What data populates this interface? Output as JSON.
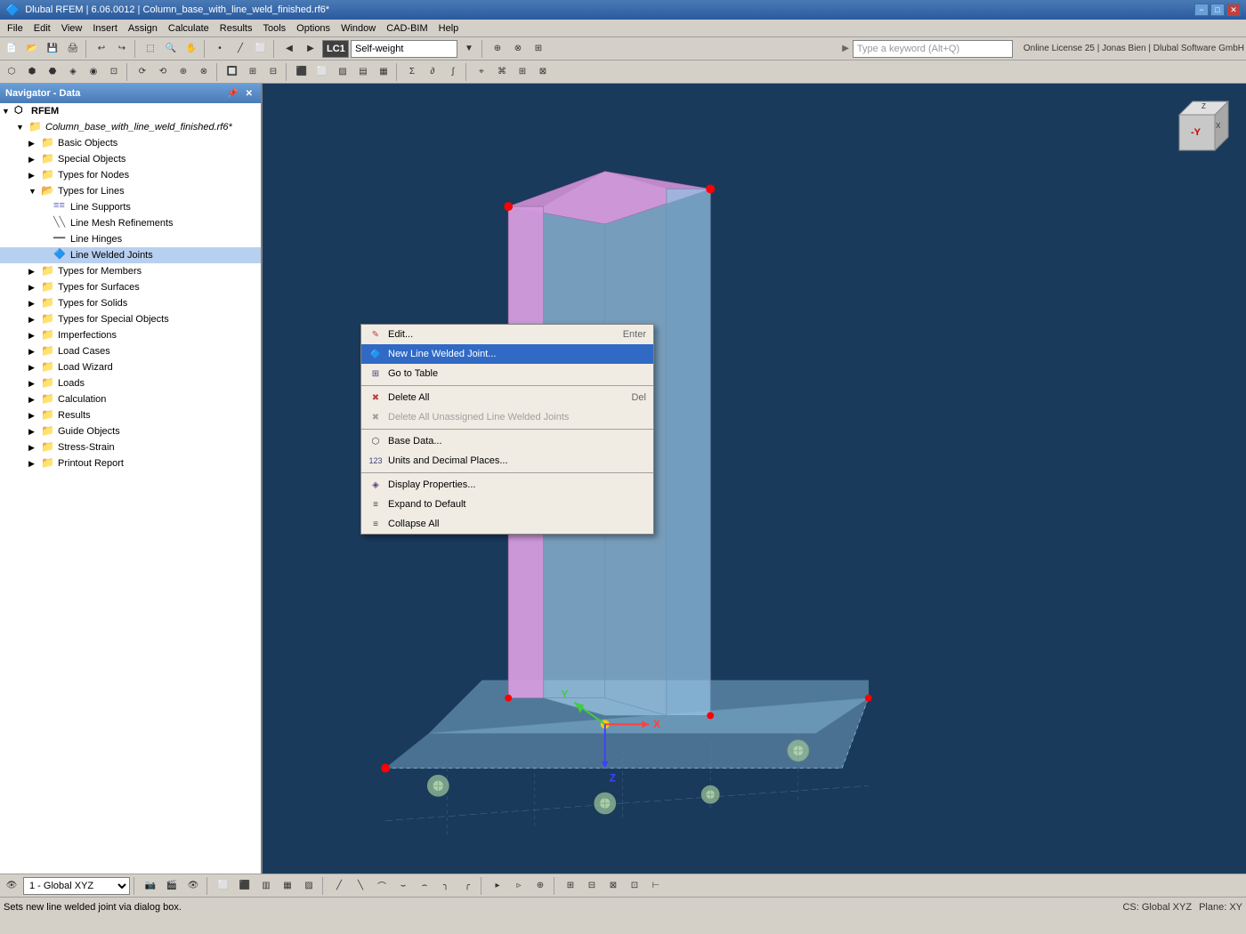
{
  "titlebar": {
    "title": "Dlubal RFEM | 6.06.0012 | Column_base_with_line_weld_finished.rf6*",
    "minimize": "−",
    "maximize": "□",
    "close": "✕"
  },
  "menubar": {
    "items": [
      "File",
      "Edit",
      "View",
      "Insert",
      "Assign",
      "Calculate",
      "Results",
      "Tools",
      "Options",
      "Window",
      "CAD-BIM",
      "Help"
    ]
  },
  "topbar": {
    "search_placeholder": "Type a keyword (Alt+Q)",
    "license_info": "Online License 25 | Jonas Bien | Dlubal Software GmbH",
    "lc_label": "LC1",
    "load_case": "Self-weight"
  },
  "navigator": {
    "title": "Navigator - Data",
    "root": "RFEM",
    "file": "Column_base_with_line_weld_finished.rf6*",
    "tree_items": [
      {
        "label": "Basic Objects",
        "level": 2,
        "type": "folder",
        "expanded": false
      },
      {
        "label": "Special Objects",
        "level": 2,
        "type": "folder",
        "expanded": false
      },
      {
        "label": "Types for Nodes",
        "level": 2,
        "type": "folder",
        "expanded": false
      },
      {
        "label": "Types for Lines",
        "level": 2,
        "type": "folder",
        "expanded": true
      },
      {
        "label": "Line Supports",
        "level": 3,
        "type": "item"
      },
      {
        "label": "Line Mesh Refinements",
        "level": 3,
        "type": "item"
      },
      {
        "label": "Line Hinges",
        "level": 3,
        "type": "item"
      },
      {
        "label": "Line Welded Joints",
        "level": 3,
        "type": "item",
        "selected": true
      },
      {
        "label": "Types for Members",
        "level": 2,
        "type": "folder",
        "expanded": false
      },
      {
        "label": "Types for Surfaces",
        "level": 2,
        "type": "folder",
        "expanded": false
      },
      {
        "label": "Types for Solids",
        "level": 2,
        "type": "folder",
        "expanded": false
      },
      {
        "label": "Types for Special Objects",
        "level": 2,
        "type": "folder",
        "expanded": false
      },
      {
        "label": "Imperfections",
        "level": 2,
        "type": "folder",
        "expanded": false
      },
      {
        "label": "Load Cases",
        "level": 2,
        "type": "folder",
        "expanded": false
      },
      {
        "label": "Load Wizard",
        "level": 2,
        "type": "folder",
        "expanded": false
      },
      {
        "label": "Loads",
        "level": 2,
        "type": "folder",
        "expanded": false
      },
      {
        "label": "Calculation",
        "level": 2,
        "type": "folder",
        "expanded": false
      },
      {
        "label": "Results",
        "level": 2,
        "type": "folder",
        "expanded": false
      },
      {
        "label": "Guide Objects",
        "level": 2,
        "type": "folder",
        "expanded": false
      },
      {
        "label": "Stress-Strain",
        "level": 2,
        "type": "folder",
        "expanded": false
      },
      {
        "label": "Printout Report",
        "level": 2,
        "type": "folder",
        "expanded": false
      }
    ]
  },
  "context_menu": {
    "items": [
      {
        "label": "Edit...",
        "shortcut": "Enter",
        "icon": "edit",
        "type": "item",
        "disabled": false
      },
      {
        "label": "New Line Welded Joint...",
        "shortcut": "",
        "icon": "new",
        "type": "item",
        "highlighted": true
      },
      {
        "label": "Go to Table",
        "shortcut": "",
        "icon": "table",
        "type": "item"
      },
      {
        "type": "sep"
      },
      {
        "label": "Delete All",
        "shortcut": "Del",
        "icon": "delete",
        "type": "item"
      },
      {
        "label": "Delete All Unassigned Line Welded Joints",
        "shortcut": "",
        "icon": "delete-grey",
        "type": "item",
        "disabled": true
      },
      {
        "type": "sep"
      },
      {
        "label": "Base Data...",
        "shortcut": "",
        "icon": "base",
        "type": "item"
      },
      {
        "label": "Units and Decimal Places...",
        "shortcut": "",
        "icon": "units",
        "type": "item"
      },
      {
        "type": "sep"
      },
      {
        "label": "Display Properties...",
        "shortcut": "",
        "icon": "display",
        "type": "item"
      },
      {
        "label": "Expand to Default",
        "shortcut": "",
        "icon": "expand",
        "type": "item"
      },
      {
        "label": "Collapse All",
        "shortcut": "",
        "icon": "collapse",
        "type": "item"
      }
    ]
  },
  "statusbar": {
    "left": "Sets new line welded joint via dialog box.",
    "cs": "CS: Global XYZ",
    "plane": "Plane: XY"
  },
  "bottom_toolbar": {
    "view_combo": "1 - Global XYZ"
  }
}
